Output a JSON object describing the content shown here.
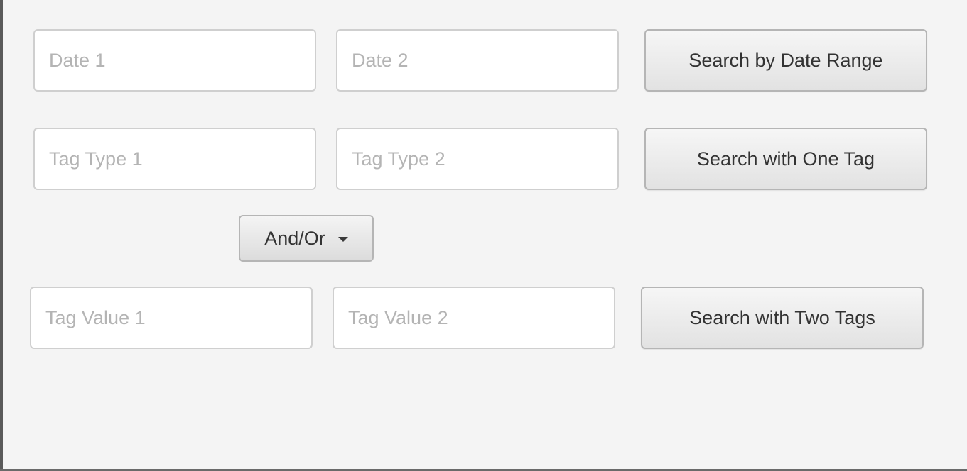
{
  "date_row": {
    "date1_placeholder": "Date 1",
    "date2_placeholder": "Date 2",
    "search_button_label": "Search by Date Range"
  },
  "tag_type_row": {
    "tag_type1_placeholder": "Tag Type 1",
    "tag_type2_placeholder": "Tag Type 2",
    "search_button_label": "Search with One Tag"
  },
  "operator_dropdown": {
    "selected_label": "And/Or",
    "icon": "chevron-down-icon"
  },
  "tag_value_row": {
    "tag_value1_placeholder": "Tag Value 1",
    "tag_value2_placeholder": "Tag Value 2",
    "search_button_label": "Search with Two Tags"
  }
}
